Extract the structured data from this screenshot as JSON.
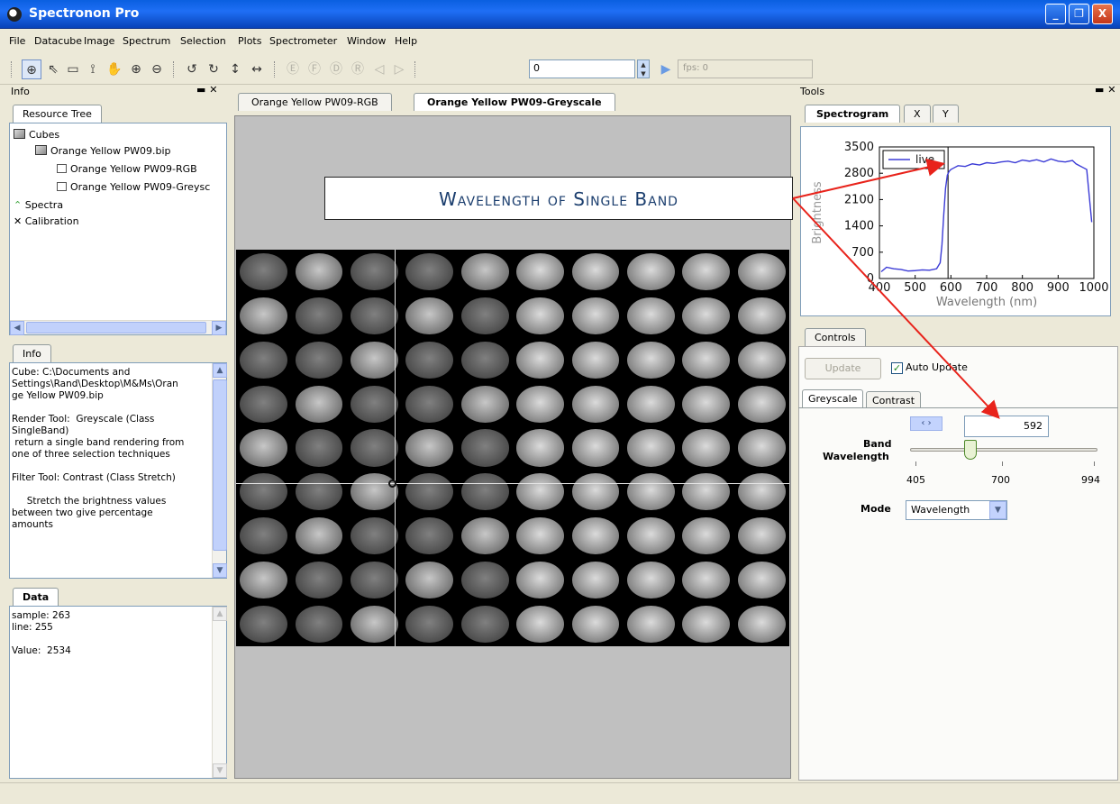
{
  "window": {
    "title": "Spectronon Pro",
    "minimize": "_",
    "restore": "❐",
    "close": "X"
  },
  "menu": [
    "File",
    "Datacube",
    "Image",
    "Spectrum",
    "Selection",
    "Plots",
    "Spectrometer",
    "Window",
    "Help"
  ],
  "toolbar": {
    "frame_value": "0",
    "fps_label": "fps: 0",
    "buttons": [
      "⊕",
      "⇖",
      "▭",
      "⟟",
      "✋",
      "⊕",
      "⊖",
      "↺",
      "↻",
      "↕",
      "↔",
      "Ⓔ",
      "Ⓕ",
      "Ⓓ",
      "Ⓡ",
      "◁",
      "▷",
      "▶"
    ]
  },
  "left": {
    "info_header": "Info",
    "close_glyph": "▬ ✕",
    "resource_tab": "Resource Tree",
    "tree": {
      "cubes": "Cubes",
      "cube_file": "Orange Yellow PW09.bip",
      "rgb_item": "Orange Yellow PW09-RGB",
      "grey_item": "Orange Yellow PW09-Greysc",
      "spectra": "Spectra",
      "calibration": "Calibration"
    },
    "info_tab": "Info",
    "info_text": "Cube: C:\\Documents and\nSettings\\Rand\\Desktop\\M&Ms\\Oran\nge Yellow PW09.bip\n\nRender Tool:  Greyscale (Class\nSingleBand)\n return a single band rendering from\none of three selection techniques\n\nFilter Tool: Contrast (Class Stretch)\n\n     Stretch the brightness values\nbetween two give percentage\namounts",
    "data_tab": "Data",
    "data_text": "sample: 263\nline: 255\n\nValue:  2534"
  },
  "center": {
    "tabs": [
      "Orange Yellow PW09-RGB",
      "Orange Yellow PW09-Greyscale"
    ],
    "active_tab": 1,
    "callout": "Wavelength of Single Band"
  },
  "right": {
    "tools_header": "Tools",
    "tool_tabs": [
      "Spectrogram",
      "X",
      "Y"
    ],
    "controls_tab": "Controls",
    "update_button": "Update",
    "auto_update_label": "Auto Update",
    "auto_update_checked": true,
    "render_tabs": [
      "Greyscale",
      "Contrast"
    ],
    "band_label_1": "Band",
    "band_label_2": "Wavelength",
    "band_value": "592",
    "slider_ticks": [
      "405",
      "700",
      "994"
    ],
    "slider_range": [
      405,
      994
    ],
    "slider_value": 592,
    "mode_label": "Mode",
    "mode_value": "Wavelength",
    "stepper_glyph": "‹ ›"
  },
  "colors": {
    "accent": "#1f6ff5",
    "series_line": "#3b3bd6",
    "arrow": "#e8231b",
    "callout_text": "#1b3e6e"
  },
  "chart_data": {
    "type": "line",
    "xlabel": "Wavelength (nm)",
    "ylabel": "Brightness",
    "xlim": [
      400,
      1000
    ],
    "ylim": [
      0,
      3500
    ],
    "xticks": [
      400,
      500,
      600,
      700,
      800,
      900,
      1000
    ],
    "yticks": [
      0,
      700,
      1400,
      2100,
      2800,
      3500
    ],
    "legend": "top-left",
    "marker_wavelength": 592,
    "series": [
      {
        "name": "live",
        "x": [
          405,
          420,
          440,
          460,
          480,
          500,
          520,
          540,
          560,
          570,
          575,
          580,
          585,
          590,
          595,
          600,
          610,
          620,
          640,
          660,
          680,
          700,
          720,
          740,
          760,
          780,
          800,
          820,
          840,
          860,
          880,
          900,
          920,
          940,
          950,
          960,
          970,
          980,
          985,
          990,
          994
        ],
        "y": [
          180,
          300,
          260,
          240,
          200,
          210,
          230,
          220,
          260,
          420,
          900,
          1700,
          2400,
          2750,
          2850,
          2900,
          2950,
          3000,
          2980,
          3050,
          3020,
          3080,
          3060,
          3100,
          3120,
          3080,
          3150,
          3120,
          3160,
          3100,
          3180,
          3120,
          3100,
          3140,
          3050,
          3000,
          2950,
          2900,
          2400,
          1900,
          1500
        ]
      }
    ]
  }
}
